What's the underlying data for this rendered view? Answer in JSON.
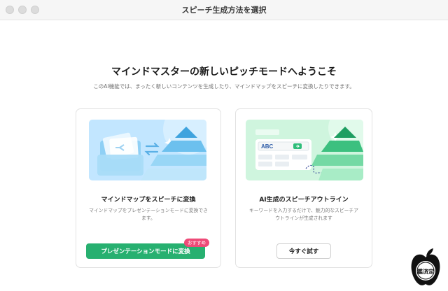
{
  "window": {
    "title": "スピーチ生成方法を選択"
  },
  "main": {
    "heading": "マインドマスターの新しいピッチモードへようこそ",
    "subheading": "このAI機能では、まったく新しいコンテンツを生成したり、マインドマップをスピーチに変換したりできます。"
  },
  "cards": [
    {
      "title": "マインドマップをスピーチに変換",
      "description": "マインドマップをプレゼンテーションモードに変換できます。",
      "button_label": "プレゼンテーションモードに変換",
      "badge": "おすすめ",
      "colors": {
        "illustration_bg": "#bfe5ff",
        "button": "#27b070"
      }
    },
    {
      "title": "AI生成のスピーチアウトライン",
      "description": "キーワードを入力するだけで、魅力的なスピーチアウトラインが生成されます",
      "button_label": "今すぐ試す",
      "illustration_text": "ABC",
      "colors": {
        "illustration_bg": "#cdf4dc",
        "button": "#ffffff"
      }
    }
  ],
  "watermark": {
    "text": "鑑定済"
  }
}
